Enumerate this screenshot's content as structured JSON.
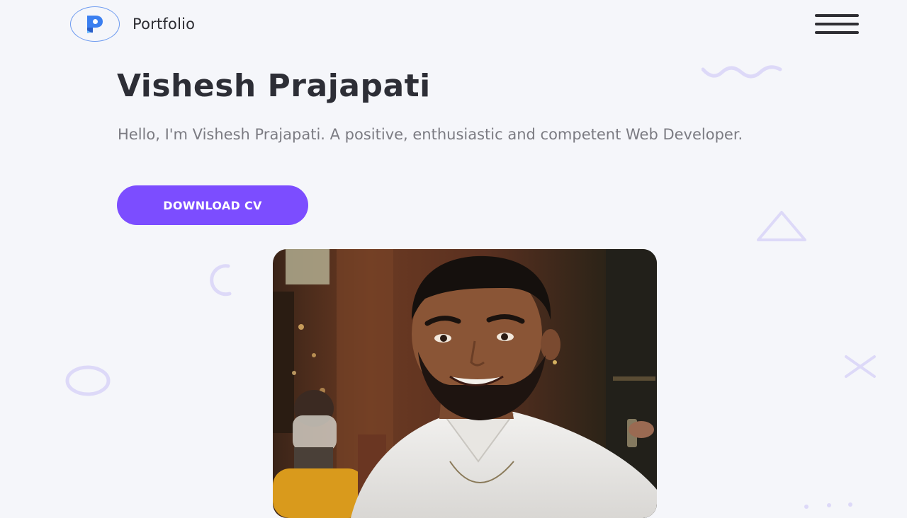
{
  "header": {
    "logo_icon": "p-logo-icon",
    "brand": "Portfolio",
    "menu_icon": "hamburger-menu-icon"
  },
  "hero": {
    "name": "Vishesh Prajapati",
    "intro": "Hello, I'm Vishesh Prajapati. A positive, enthusiastic and competent Web Developer.",
    "cta_label": "DOWNLOAD CV"
  },
  "profile_photo": {
    "subject": "portrait-photo"
  },
  "decorations": [
    "wave-icon",
    "triangle-icon",
    "crescent-icon",
    "ring-icon",
    "cross-icon",
    "dots-icon"
  ],
  "colors": {
    "background": "#f5f6fa",
    "accent": "#7c4dff",
    "logo_border": "#6f9cf0",
    "logo_blue": "#3b7ff0",
    "decor": "#ddd9f8",
    "heading": "#2d2e36",
    "body_text": "#7b7b82"
  }
}
